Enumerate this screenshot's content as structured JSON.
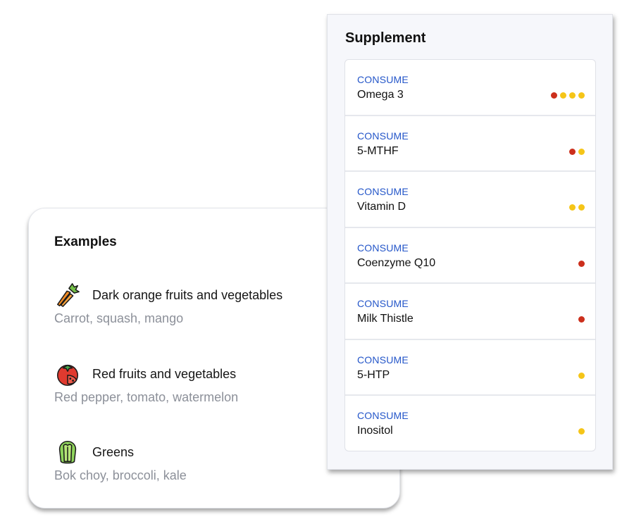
{
  "examples": {
    "title": "Examples",
    "items": [
      {
        "icon": "carrot-icon",
        "title": "Dark orange fruits and vegetables",
        "subtitle": "Carrot, squash, mango"
      },
      {
        "icon": "tomato-icon",
        "title": "Red fruits and vegetables",
        "subtitle": "Red pepper, tomato, watermelon"
      },
      {
        "icon": "lettuce-icon",
        "title": "Greens",
        "subtitle": "Bok choy, broccoli, kale"
      }
    ]
  },
  "supplement": {
    "title": "Supplement",
    "colors": {
      "red": "#cc2f1c",
      "yellow": "#f5c518",
      "label_blue": "#2456c9"
    },
    "rows": [
      {
        "label": "CONSUME",
        "name": "Omega 3",
        "dots": [
          "red",
          "yellow",
          "yellow",
          "yellow"
        ]
      },
      {
        "label": "CONSUME",
        "name": "5-MTHF",
        "dots": [
          "red",
          "yellow"
        ]
      },
      {
        "label": "CONSUME",
        "name": "Vitamin D",
        "dots": [
          "yellow",
          "yellow"
        ]
      },
      {
        "label": "CONSUME",
        "name": "Coenzyme Q10",
        "dots": [
          "red"
        ]
      },
      {
        "label": "CONSUME",
        "name": "Milk Thistle",
        "dots": [
          "red"
        ]
      },
      {
        "label": "CONSUME",
        "name": "5-HTP",
        "dots": [
          "yellow"
        ]
      },
      {
        "label": "CONSUME",
        "name": "Inositol",
        "dots": [
          "yellow"
        ]
      }
    ]
  }
}
